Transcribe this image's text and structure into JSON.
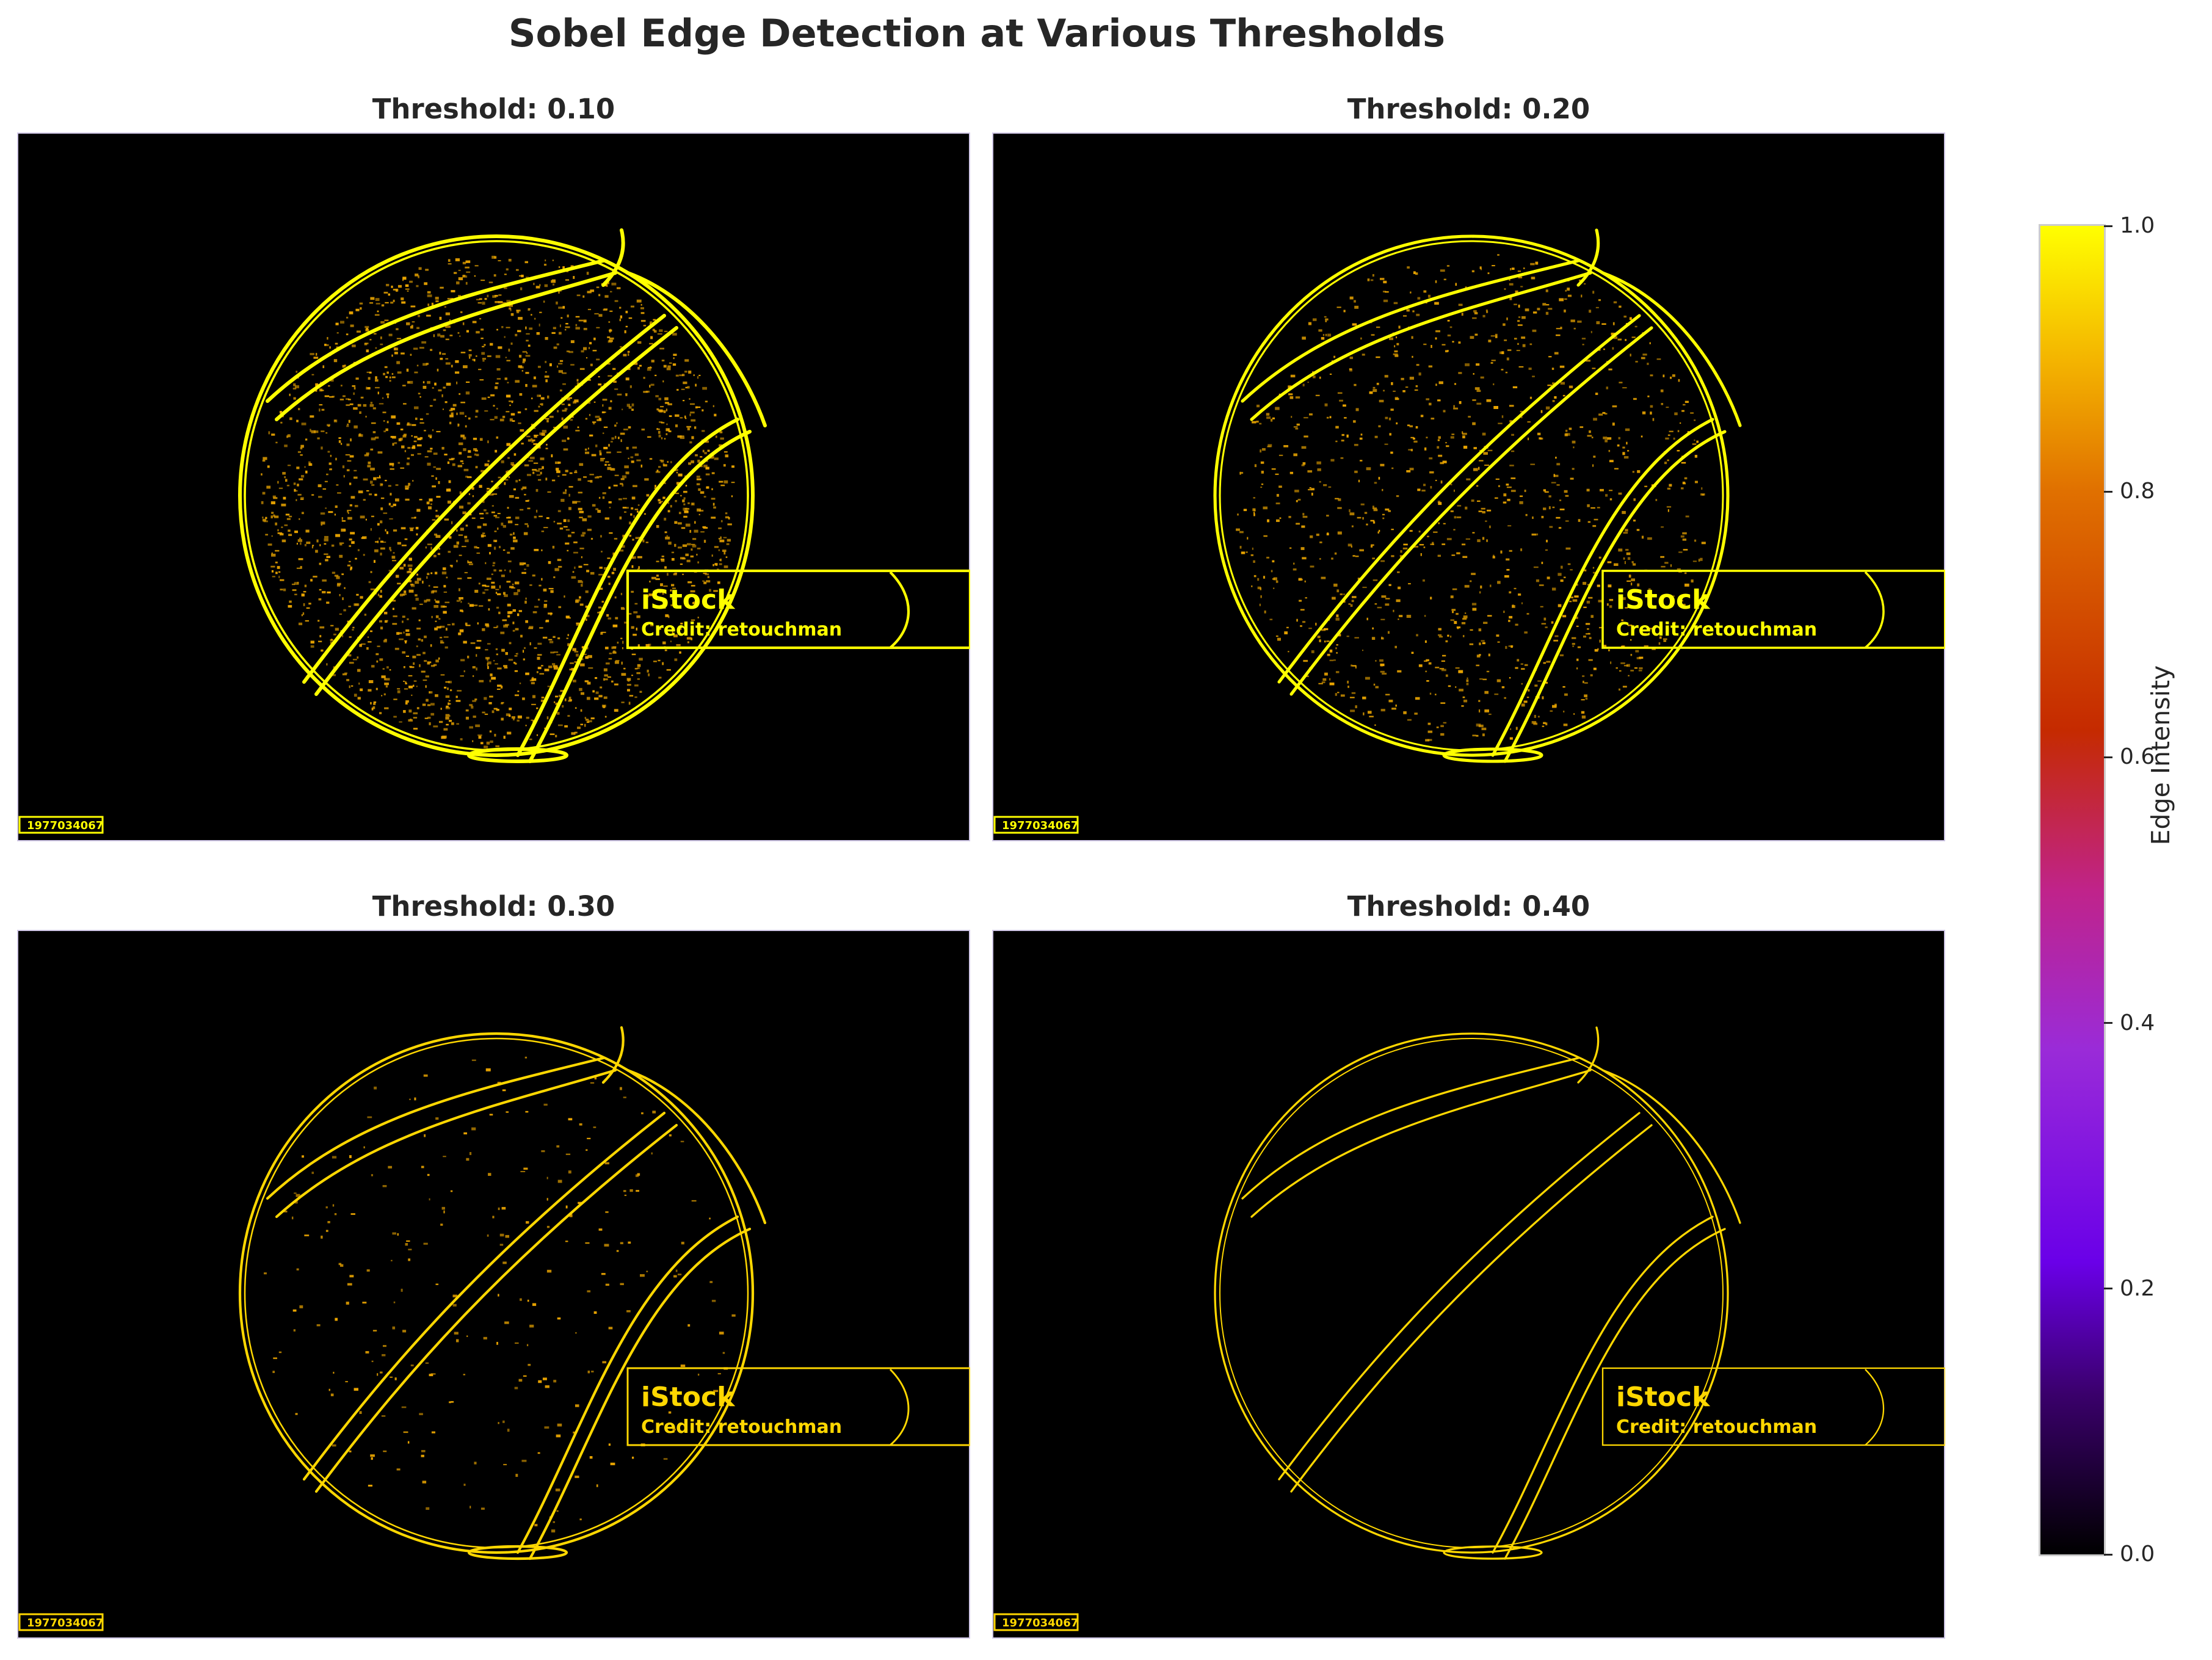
{
  "title": "Sobel Edge Detection at Various Thresholds",
  "panels": [
    {
      "title": "Threshold: 0.10",
      "threshold": 0.1,
      "texture_density": 0.9
    },
    {
      "title": "Threshold: 0.20",
      "threshold": 0.2,
      "texture_density": 0.45
    },
    {
      "title": "Threshold: 0.30",
      "threshold": 0.3,
      "texture_density": 0.1
    },
    {
      "title": "Threshold: 0.40",
      "threshold": 0.4,
      "texture_density": 0.0
    }
  ],
  "watermark": {
    "brand": "iStock",
    "credit": "Credit: retouchman",
    "id": "1977034067"
  },
  "colorbar": {
    "label": "Edge Intensity",
    "ticks": [
      "0.0",
      "0.2",
      "0.4",
      "0.6",
      "0.8",
      "1.0"
    ],
    "colormap": "gnuplot2-like",
    "range": [
      0.0,
      1.0
    ]
  },
  "colors": {
    "edge": "#ffd700",
    "edge_bright": "#ffff00",
    "texture": "#e9a400",
    "background": "#000000"
  },
  "chart_data": {
    "type": "heatmap",
    "title": "Sobel Edge Detection at Various Thresholds",
    "subplots": [
      "Threshold: 0.10",
      "Threshold: 0.20",
      "Threshold: 0.30",
      "Threshold: 0.40"
    ],
    "thresholds": [
      0.1,
      0.2,
      0.3,
      0.4
    ],
    "colorbar_label": "Edge Intensity",
    "colorbar_range": [
      0.0,
      1.0
    ],
    "colorbar_ticks": [
      0.0,
      0.2,
      0.4,
      0.6,
      0.8,
      1.0
    ],
    "grid": false
  }
}
